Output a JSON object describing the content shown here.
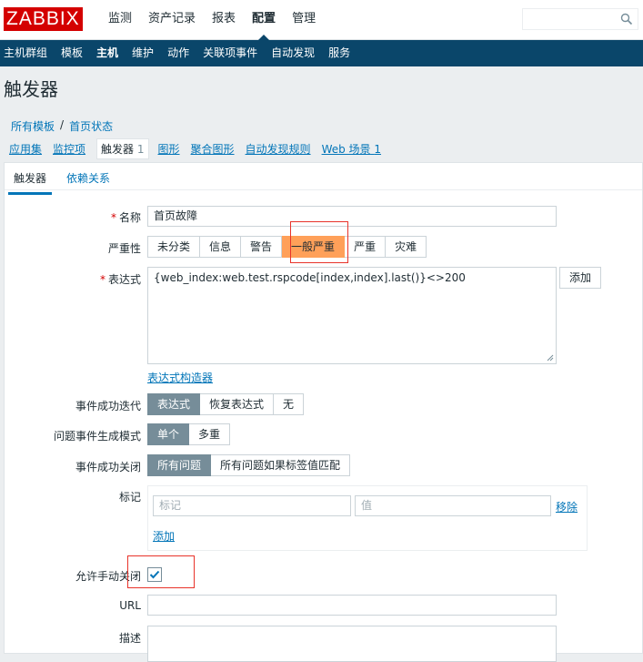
{
  "header": {
    "logo": "ZABBIX",
    "menu": [
      "监测",
      "资产记录",
      "报表",
      "配置",
      "管理"
    ],
    "active_menu_index": 3
  },
  "subnav": [
    "主机群组",
    "模板",
    "主机",
    "维护",
    "动作",
    "关联项事件",
    "自动发现",
    "服务"
  ],
  "subnav_active_index": 2,
  "page_title": "触发器",
  "breadcrumb": {
    "root": "所有模板",
    "separator": "/",
    "current": "首页状态"
  },
  "entity_tabs": {
    "apps": "应用集",
    "items": "监控项",
    "triggers": "触发器",
    "triggers_count": "1",
    "graphs": "图形",
    "screens": "聚合图形",
    "discovery": "自动发现规则",
    "web": "Web 场景",
    "web_count": "1"
  },
  "form_tabs": {
    "trigger": "触发器",
    "dependencies": "依赖关系"
  },
  "form": {
    "name_label": "名称",
    "name_value": "首页故障",
    "severity_label": "严重性",
    "severity_options": [
      "未分类",
      "信息",
      "警告",
      "一般严重",
      "严重",
      "灾难"
    ],
    "severity_selected_index": 3,
    "expression_label": "表达式",
    "expression_value": "{web_index:web.test.rspcode[index,index].last()}<>200",
    "add_button": "添加",
    "expression_builder": "表达式构造器",
    "ok_event_label": "事件成功迭代",
    "ok_event_options": [
      "表达式",
      "恢复表达式",
      "无"
    ],
    "ok_event_selected": 0,
    "problem_mode_label": "问题事件生成模式",
    "problem_mode_options": [
      "单个",
      "多重"
    ],
    "problem_mode_selected": 0,
    "ok_close_label": "事件成功关闭",
    "ok_close_options": [
      "所有问题",
      "所有问题如果标签值匹配"
    ],
    "ok_close_selected": 0,
    "tags_label": "标记",
    "tag_placeholder": "标记",
    "value_placeholder": "值",
    "remove_link": "移除",
    "tags_add_link": "添加",
    "manual_close_label": "允许手动关闭",
    "manual_close_checked": true,
    "url_label": "URL",
    "desc_label": "描述"
  },
  "colors": {
    "brand": "#d40000",
    "subnav_bg": "#0a466a",
    "selected_segment": "#768d99",
    "severity_average": "#ffa059",
    "link": "#0275b8",
    "highlight_box": "#e8332a"
  }
}
